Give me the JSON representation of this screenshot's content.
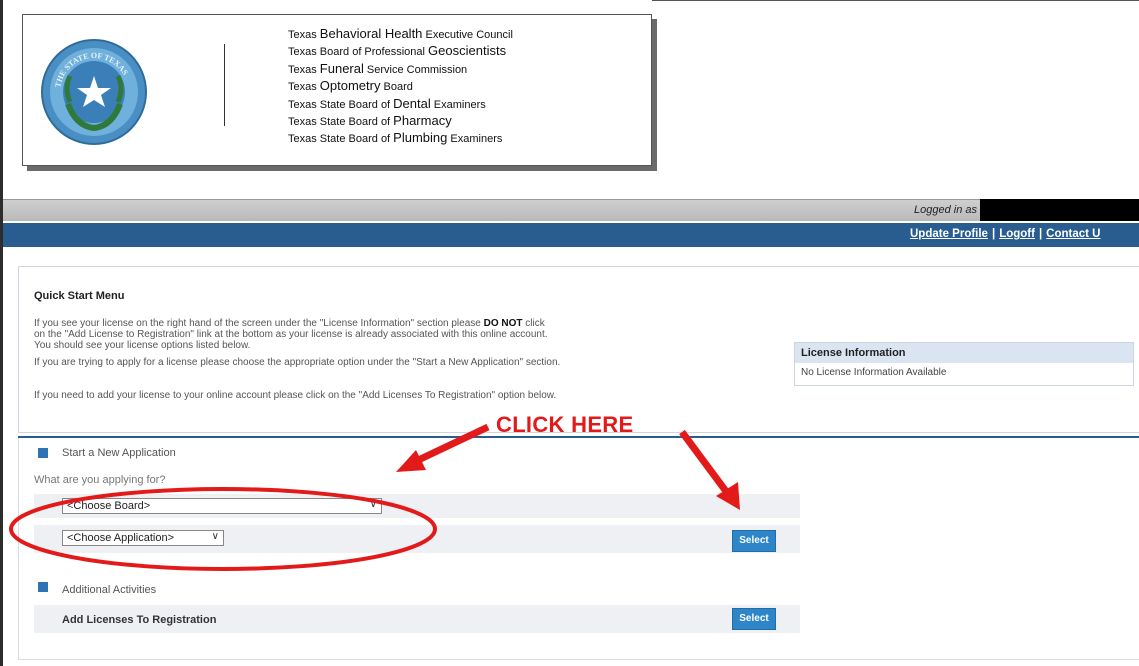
{
  "header": {
    "agencies": [
      {
        "pre": "Texas ",
        "big": "Behavioral Health",
        "post": " Executive Council"
      },
      {
        "pre": "Texas Board of Professional ",
        "big": "Geoscientists",
        "post": ""
      },
      {
        "pre": "Texas ",
        "big": "Funeral",
        "post": " Service Commission"
      },
      {
        "pre": "Texas ",
        "big": "Optometry",
        "post": " Board"
      },
      {
        "pre": "Texas State Board of ",
        "big": "Dental",
        "post": " Examiners"
      },
      {
        "pre": "Texas State Board of ",
        "big": "Pharmacy",
        "post": ""
      },
      {
        "pre": "Texas State Board of ",
        "big": "Plumbing",
        "post": " Examiners"
      }
    ],
    "seal_text": "THE STATE OF TEXAS",
    "logged_in_text": "Logged in as",
    "nav": {
      "update_profile": "Update Profile",
      "separator": "|",
      "logoff": "Logoff",
      "contact": "Contact U"
    }
  },
  "quick_start": {
    "title": "Quick Start Menu",
    "para1_line1_pre": "If you see your license on the right hand of the screen under the \"License Information\" section please ",
    "para1_line1_bold": "DO NOT",
    "para1_line1_post": " click",
    "para1_line2": "on the \"Add License to Registration\" link at the bottom as your license is already associated with this online account.",
    "para1_line3": "You should see your license options listed below.",
    "para2": "If you are trying to apply for a license please choose the appropriate option under the \"Start a New Application\" section.",
    "para3": "If you need to add your license to your online account please click on the \"Add Licenses To Registration\" option below."
  },
  "license_info": {
    "title": "License Information",
    "body": "No License Information Available"
  },
  "application": {
    "section_label": "Start a New Application",
    "question": "What are you applying for?",
    "board_select": "<Choose Board>",
    "app_select": "<Choose Application>",
    "select_button": "Select"
  },
  "activities": {
    "section_label": "Additional Activities",
    "add_licenses_label": "Add Licenses To Registration",
    "select_button": "Select"
  },
  "annotation": {
    "click_here": "CLICK HERE",
    "color": "#e21a1a"
  },
  "colors": {
    "nav_blue": "#2a5d8f",
    "button_blue": "#2e86c8",
    "license_header_bg": "#dbe5f1"
  }
}
